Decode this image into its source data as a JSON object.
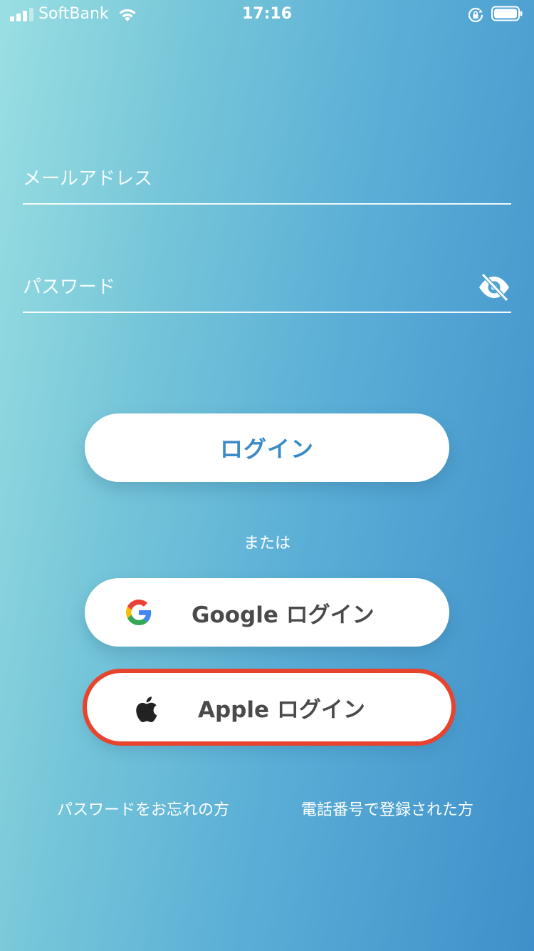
{
  "status_bar": {
    "carrier": "SoftBank",
    "time": "17:16",
    "icons": [
      "signal-bars-icon",
      "wifi-icon",
      "orientation-lock-icon",
      "battery-icon"
    ]
  },
  "form": {
    "email_placeholder": "メールアドレス",
    "email_value": "",
    "password_placeholder": "パスワード",
    "password_value": "",
    "visibility_icon": "eye-slash-icon"
  },
  "buttons": {
    "login_label": "ログイン",
    "or_text": "または",
    "google_label": "Google ログイン",
    "google_icon": "google-g-icon",
    "apple_label": "Apple ログイン",
    "apple_icon": "apple-logo-icon"
  },
  "links": {
    "forgot_password": "パスワードをお忘れの方",
    "phone_registered": "電話番号で登録された方"
  },
  "colors": {
    "gradient_start": "#9adfe2",
    "gradient_end": "#3f8fca",
    "login_text": "#3b8bc6",
    "social_text": "#4a4a4a",
    "highlight_border": "#e8432c"
  }
}
